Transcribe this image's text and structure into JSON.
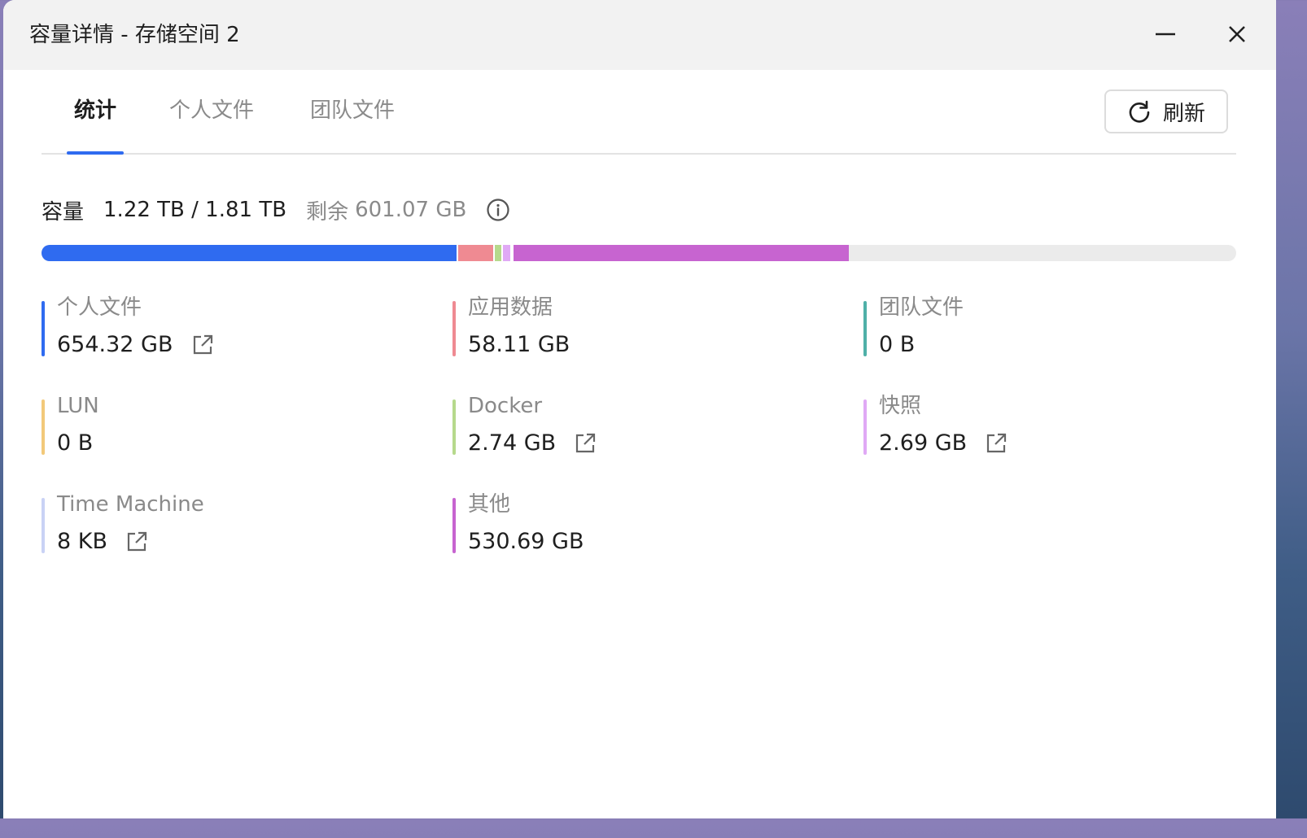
{
  "window": {
    "title": "容量详情 - 存储空间 2"
  },
  "tabs": [
    {
      "label": "统计",
      "active": true
    },
    {
      "label": "个人文件",
      "active": false
    },
    {
      "label": "团队文件",
      "active": false
    }
  ],
  "refresh_label": "刷新",
  "capacity": {
    "label": "容量",
    "used": "1.22 TB / 1.81 TB",
    "free_label": "剩余",
    "free": "601.07 GB"
  },
  "usage_bar": [
    {
      "name": "个人文件",
      "fraction": 0.3471,
      "color": "#2f6bf0"
    },
    {
      "name": "应用数据",
      "fraction": 0.031,
      "color": "#ef8a92"
    },
    {
      "name": "Docker",
      "fraction": 0.007,
      "color": "#b6d98c"
    },
    {
      "name": "快照",
      "fraction": 0.007,
      "color": "#e0a9f5"
    },
    {
      "name": "Time Machine",
      "fraction": 0.002,
      "color": "#c9d2f5"
    },
    {
      "name": "其他",
      "fraction": 0.282,
      "color": "#c764d0"
    }
  ],
  "items": [
    {
      "name": "个人文件",
      "value": "654.32 GB",
      "color": "#2f6bf0",
      "link": true
    },
    {
      "name": "应用数据",
      "value": "58.11 GB",
      "color": "#ef8a92",
      "link": false
    },
    {
      "name": "团队文件",
      "value": "0 B",
      "color": "#4fb0a8",
      "link": false
    },
    {
      "name": "LUN",
      "value": "0 B",
      "color": "#f2c97a",
      "link": false
    },
    {
      "name": "Docker",
      "value": "2.74 GB",
      "color": "#b6d98c",
      "link": true
    },
    {
      "name": "快照",
      "value": "2.69 GB",
      "color": "#e0a9f5",
      "link": true
    },
    {
      "name": "Time Machine",
      "value": "8 KB",
      "color": "#c9d2f5",
      "link": true
    },
    {
      "name": "其他",
      "value": "530.69 GB",
      "color": "#c764d0",
      "link": false
    }
  ]
}
